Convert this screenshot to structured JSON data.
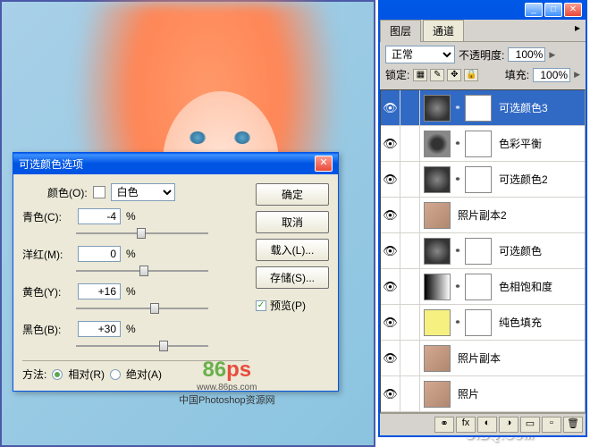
{
  "dialog": {
    "title": "可选颜色选项",
    "color_label": "颜色(O):",
    "color_value": "白色",
    "sliders": {
      "cyan": {
        "label": "青色(C):",
        "value": "-4"
      },
      "magenta": {
        "label": "洋红(M):",
        "value": "0"
      },
      "yellow": {
        "label": "黄色(Y):",
        "value": "+16"
      },
      "black": {
        "label": "黑色(B):",
        "value": "+30"
      }
    },
    "percent": "%",
    "method_label": "方法:",
    "method_relative": "相对(R)",
    "method_absolute": "绝对(A)",
    "buttons": {
      "ok": "确定",
      "cancel": "取消",
      "load": "载入(L)...",
      "save": "存储(S)..."
    },
    "preview": "预览(P)"
  },
  "panel": {
    "tabs": {
      "layers": "图层",
      "channels": "通道"
    },
    "blend_mode": "正常",
    "opacity_label": "不透明度:",
    "opacity_value": "100%",
    "lock_label": "锁定:",
    "fill_label": "填充:",
    "fill_value": "100%",
    "layers": [
      {
        "name": "可选颜色3",
        "type": "adj",
        "selected": true
      },
      {
        "name": "色彩平衡",
        "type": "cb",
        "selected": false
      },
      {
        "name": "可选颜色2",
        "type": "adj",
        "selected": false
      },
      {
        "name": "照片副本2",
        "type": "img",
        "selected": false
      },
      {
        "name": "可选颜色",
        "type": "adj",
        "selected": false
      },
      {
        "name": "色相饱和度",
        "type": "grad",
        "selected": false
      },
      {
        "name": "纯色填充",
        "type": "fill",
        "selected": false
      },
      {
        "name": "照片副本",
        "type": "img",
        "selected": false
      },
      {
        "name": "照片",
        "type": "img",
        "selected": false
      }
    ]
  },
  "watermark": {
    "brand": "86ps",
    "url": "www.86ps.com",
    "tagline": "中国Photoshop资源网",
    "uibq": "UiBQ.CoM"
  }
}
